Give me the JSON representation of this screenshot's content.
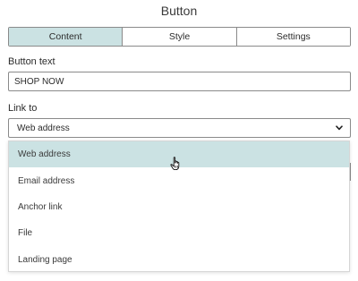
{
  "panel": {
    "title": "Button"
  },
  "tabs": [
    {
      "label": "Content",
      "active": true
    },
    {
      "label": "Style",
      "active": false
    },
    {
      "label": "Settings",
      "active": false
    }
  ],
  "button_text": {
    "label": "Button text",
    "value": "SHOP NOW"
  },
  "link_to": {
    "label": "Link to",
    "selected": "Web address",
    "chevron_icon": "chevron-down-icon",
    "options": [
      {
        "label": "Web address",
        "highlighted": true
      },
      {
        "label": "Email address",
        "highlighted": false
      },
      {
        "label": "Anchor link",
        "highlighted": false
      },
      {
        "label": "File",
        "highlighted": false
      },
      {
        "label": "Landing page",
        "highlighted": false
      }
    ]
  },
  "colors": {
    "accent": "#cbe2e3",
    "border": "#8a8a8a",
    "text": "#2b2b2b"
  },
  "cursor_icon": "hand-pointer-icon"
}
